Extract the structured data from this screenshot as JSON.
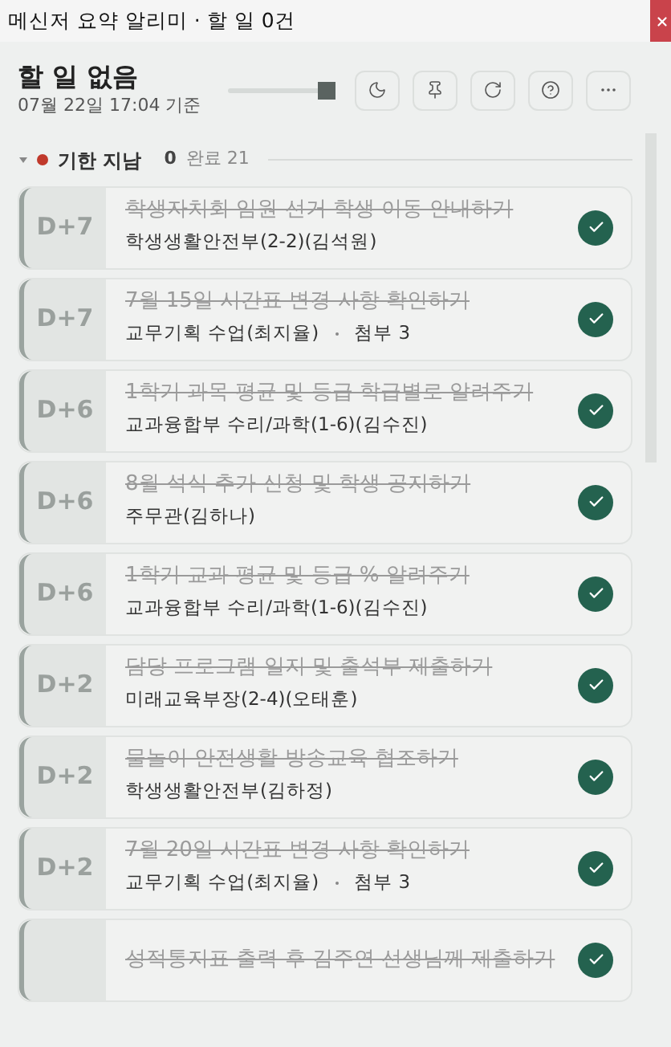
{
  "window": {
    "title": "메신저 요약 알리미 · 할 일 0건"
  },
  "header": {
    "title": "할 일 없음",
    "timestamp": "07월 22일 17:04 기준",
    "slider": {
      "level": 1
    }
  },
  "section": {
    "expanded": true,
    "color": "#c0392b",
    "label": "기한 지남",
    "count": "0",
    "done_label": "완료 21"
  },
  "tasks": [
    {
      "day": "D+7",
      "title": "학생자치회 임원 선거 학생 이동 안내하기",
      "owner": "학생생활안전부(2-2)(김석원)",
      "done": true
    },
    {
      "day": "D+7",
      "title": "7월 15일 시간표 변경 사항 확인하기",
      "owner": "교무기획 수업(최지율)",
      "attachment": "첨부 3",
      "done": true
    },
    {
      "day": "D+6",
      "title": "1학기 과목 평균 및 등급 학급별로 알려주기",
      "owner": "교과융합부 수리/과학(1-6)(김수진)",
      "done": true
    },
    {
      "day": "D+6",
      "title": "8월 석식 추가 신청 및 학생 공지하기",
      "owner": "주무관(김하나)",
      "done": true
    },
    {
      "day": "D+6",
      "title": "1학기 교과 평균 및 등급 % 알려주기",
      "owner": "교과융합부 수리/과학(1-6)(김수진)",
      "done": true
    },
    {
      "day": "D+2",
      "title": "담당 프로그램 일지 및 출석부 제출하기",
      "owner": "미래교육부장(2-4)(오태훈)",
      "done": true
    },
    {
      "day": "D+2",
      "title": "물놀이 안전생활 방송교육 협조하기",
      "owner": "학생생활안전부(김하정)",
      "done": true
    },
    {
      "day": "D+2",
      "title": "7월 20일 시간표 변경 사항 확인하기",
      "owner": "교무기획 수업(최지율)",
      "attachment": "첨부 3",
      "done": true
    },
    {
      "title": "성적통지표 출력 후 김주연 선생님께 제출하기",
      "done": true
    }
  ]
}
